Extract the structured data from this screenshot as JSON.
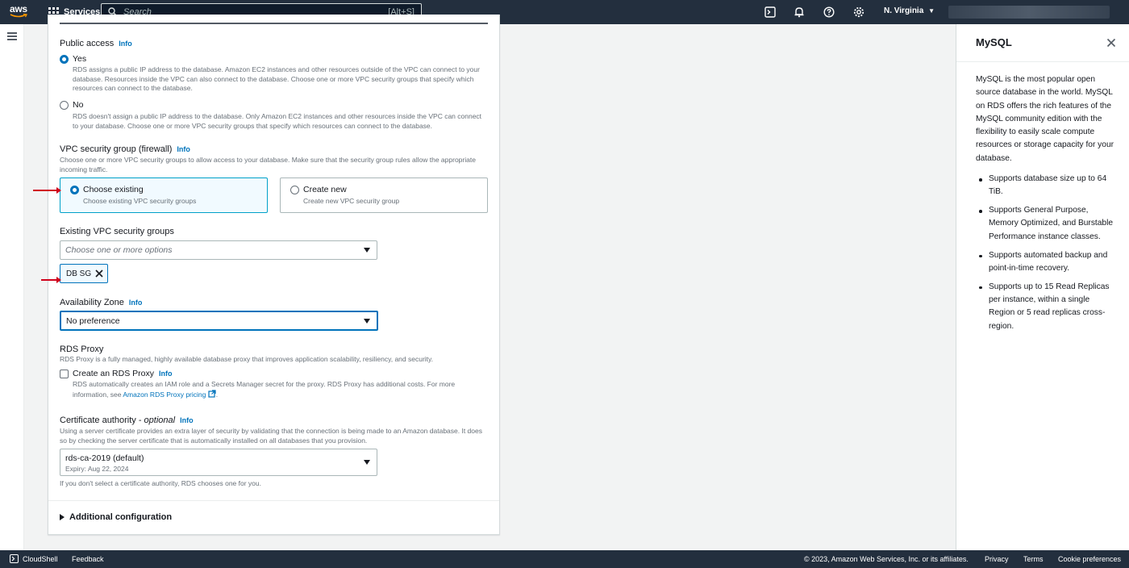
{
  "topnav": {
    "logo_text": "aws",
    "services_label": "Services",
    "search_placeholder": "Search",
    "search_shortcut": "[Alt+S]",
    "region": "N. Virginia"
  },
  "form": {
    "public_access": {
      "label": "Public access",
      "info": "Info",
      "yes_label": "Yes",
      "yes_desc": "RDS assigns a public IP address to the database. Amazon EC2 instances and other resources outside of the VPC can connect to your database. Resources inside the VPC can also connect to the database. Choose one or more VPC security groups that specify which resources can connect to the database.",
      "no_label": "No",
      "no_desc": "RDS doesn't assign a public IP address to the database. Only Amazon EC2 instances and other resources inside the VPC can connect to your database. Choose one or more VPC security groups that specify which resources can connect to the database.",
      "selected": "Yes"
    },
    "vpc_sg": {
      "label": "VPC security group (firewall)",
      "info": "Info",
      "desc": "Choose one or more VPC security groups to allow access to your database. Make sure that the security group rules allow the appropriate incoming traffic.",
      "existing_title": "Choose existing",
      "existing_sub": "Choose existing VPC security groups",
      "new_title": "Create new",
      "new_sub": "Create new VPC security group",
      "selected": "Choose existing"
    },
    "existing_groups": {
      "label": "Existing VPC security groups",
      "placeholder": "Choose one or more options",
      "tokens": [
        "DB SG"
      ]
    },
    "az": {
      "label": "Availability Zone",
      "info": "Info",
      "value": "No preference"
    },
    "rds_proxy": {
      "label": "RDS Proxy",
      "desc": "RDS Proxy is a fully managed, highly available database proxy that improves application scalability, resiliency, and security.",
      "checkbox_label": "Create an RDS Proxy",
      "info": "Info",
      "checkbox_desc": "RDS automatically creates an IAM role and a Secrets Manager secret for the proxy. RDS Proxy has additional costs. For more information, see",
      "link": "Amazon RDS Proxy pricing",
      "checked": false
    },
    "cert": {
      "label": "Certificate authority - ",
      "label_optional": "optional",
      "info": "Info",
      "desc": "Using a server certificate provides an extra layer of security by validating that the connection is being made to an Amazon database. It does so by checking the server certificate that is automatically installed on all databases that you provision.",
      "value": "rds-ca-2019 (default)",
      "expiry": "Expiry: Aug 22, 2024",
      "hint": "If you don't select a certificate authority, RDS chooses one for you."
    },
    "additional": "Additional configuration"
  },
  "help": {
    "title": "MySQL",
    "intro": "MySQL is the most popular open source database in the world. MySQL on RDS offers the rich features of the MySQL community edition with the flexibility to easily scale compute resources or storage capacity for your database.",
    "bullets": [
      "Supports database size up to 64 TiB.",
      "Supports General Purpose, Memory Optimized, and Burstable Performance instance classes.",
      "Supports automated backup and point-in-time recovery.",
      "Supports up to 15 Read Replicas per instance, within a single Region or 5 read replicas cross-region."
    ]
  },
  "footer": {
    "cloudshell": "CloudShell",
    "feedback": "Feedback",
    "copyright": "© 2023, Amazon Web Services, Inc. or its affiliates.",
    "privacy": "Privacy",
    "terms": "Terms",
    "cookies": "Cookie preferences"
  },
  "colors": {
    "nav_bg": "#232f3e",
    "accent": "#0073bb",
    "annotation_arrow": "#d0021b"
  }
}
